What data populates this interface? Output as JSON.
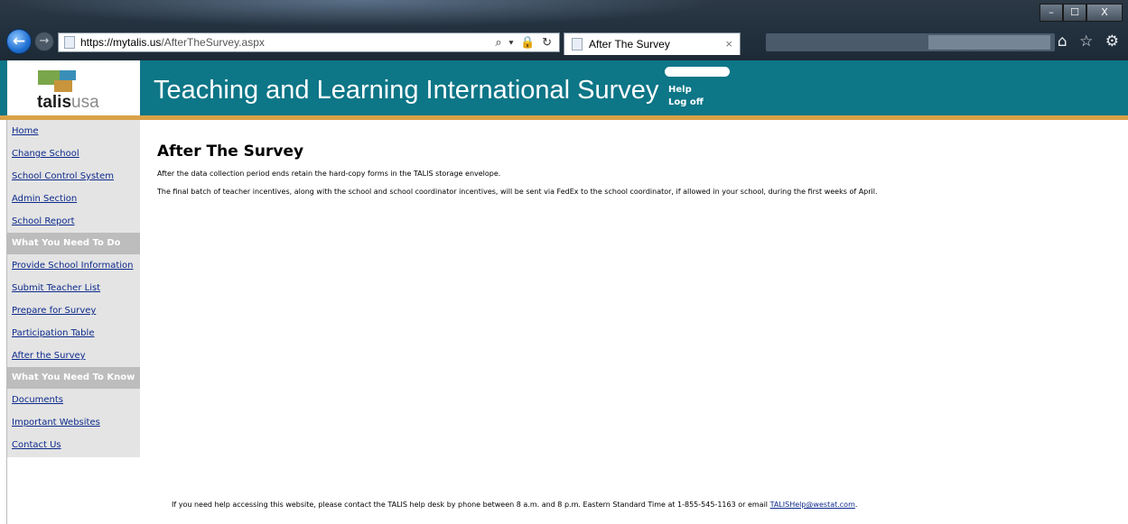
{
  "browser": {
    "url_host": "https://mytalis.us",
    "url_path": "/AfterTheSurvey.aspx",
    "address_tools": "⌕ ▾ 🔒 ↻",
    "tab_title": "After The Survey",
    "tab_close": "×",
    "window_controls": [
      "–",
      "☐",
      "X"
    ],
    "back_symbol": "←",
    "forward_symbol": "→",
    "top_icons": "⌂ ☆ ⚙"
  },
  "site": {
    "logo_bold": "talis",
    "logo_light": "usa",
    "title": "Teaching and Learning International Survey",
    "header_links": [
      "Help",
      "Log off"
    ]
  },
  "sidebar": {
    "items": [
      {
        "label": "Home",
        "type": "link"
      },
      {
        "label": "Change School",
        "type": "link"
      },
      {
        "label": "School Control System",
        "type": "link"
      },
      {
        "label": "Admin Section",
        "type": "link"
      },
      {
        "label": "School Report",
        "type": "link"
      },
      {
        "label": "What You Need To Do",
        "type": "heading"
      },
      {
        "label": "Provide School Information",
        "type": "link"
      },
      {
        "label": "Submit Teacher List",
        "type": "link"
      },
      {
        "label": "Prepare for Survey",
        "type": "link"
      },
      {
        "label": "Participation Table",
        "type": "link"
      },
      {
        "label": "After the Survey",
        "type": "link"
      },
      {
        "label": "What You Need To Know",
        "type": "heading"
      },
      {
        "label": "Documents",
        "type": "link"
      },
      {
        "label": "Important Websites",
        "type": "link"
      },
      {
        "label": "Contact Us",
        "type": "link"
      }
    ]
  },
  "main": {
    "heading": "After The Survey",
    "paragraphs": [
      "After the data collection period ends retain the hard-copy forms in the TALIS storage envelope.",
      "The final batch of teacher incentives, along with the school and school coordinator incentives, will be sent via FedEx to the school coordinator, if allowed in your school, during the first weeks of April."
    ]
  },
  "footer": {
    "text_before": "If you need help accessing this website, please contact the TALIS help desk by phone between 8 a.m. and 8 p.m. Eastern Standard Time at 1-855-545-1163 or email ",
    "email": "TALISHelp@westat.com",
    "text_after": "."
  },
  "colors": {
    "header_teal": "#0d7687",
    "accent_gold": "#d9a247",
    "link_blue": "#0c2a8c",
    "sidebar_bg": "#e4e4e4",
    "sidebar_heading_bg": "#bdbdbd"
  }
}
